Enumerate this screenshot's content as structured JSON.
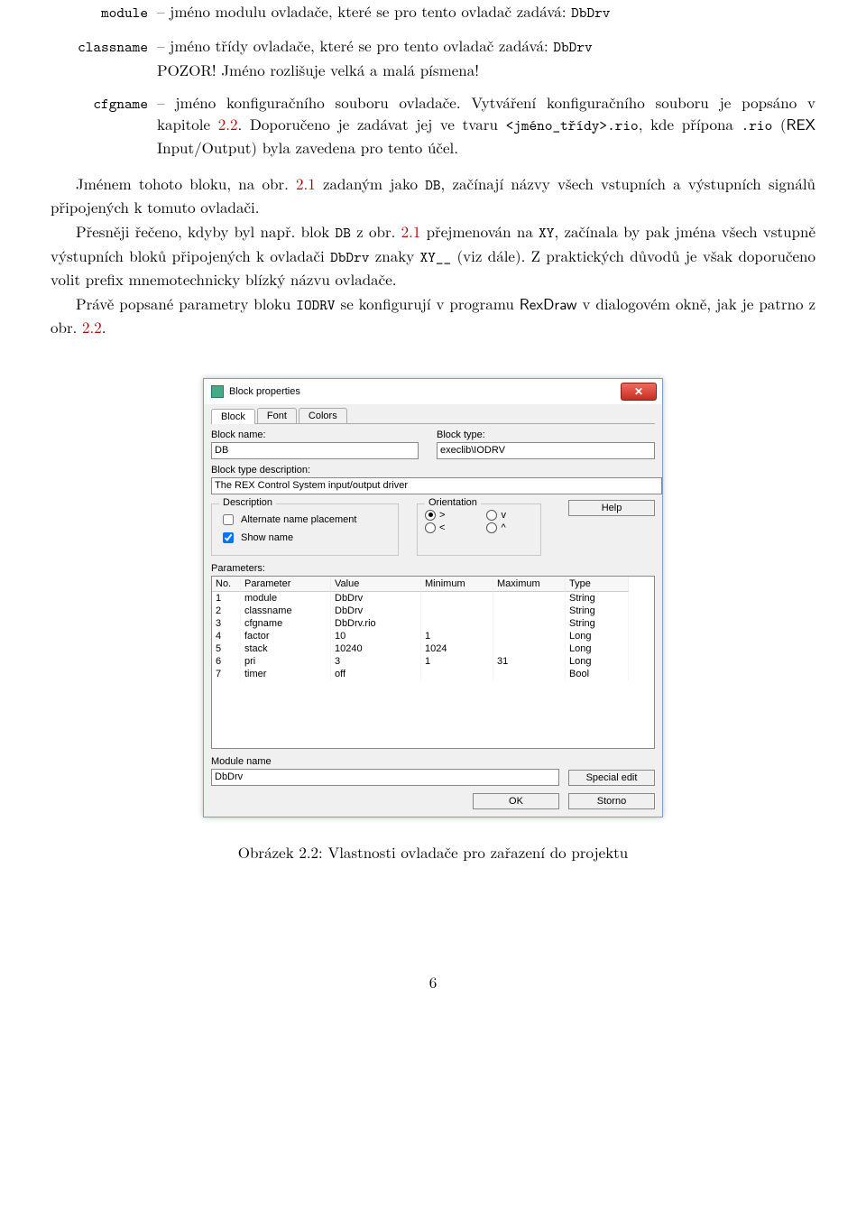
{
  "defs": {
    "module": {
      "term": "module",
      "pre": "– jméno modulu ovladače, které se pro tento ovladač zadává: ",
      "code": "DbDrv",
      "post": ""
    },
    "classname": {
      "term": "classname",
      "line1_pre": "– jméno třídy ovladače, které se pro tento ovladač zadává: ",
      "line1_code": "DbDrv",
      "line2": "POZOR! Jméno rozlišuje velká a malá písmena!"
    },
    "cfgname": {
      "term": "cfgname",
      "text_a": "– jméno konfiguračního souboru ovladače. Vytváření konfiguračního souboru je popsáno v kapitole ",
      "ref1": "2.2",
      "text_b": ". Doporučeno je zadávat jej ve tvaru ",
      "code1": "<jméno_třídy>.rio",
      "text_c": ", kde přípona ",
      "code2": ".rio",
      "text_d": " (",
      "sf1": "REX",
      "text_e": " Input/Output) byla zavedena pro tento účel."
    }
  },
  "p1": {
    "a": "Jménem tohoto bloku, na obr. ",
    "ref": "2.1",
    "b": " zadaným jako ",
    "code": "DB",
    "c": ", začínají názvy všech vstupních a výstupních signálů připojených k tomuto ovladači."
  },
  "p2": {
    "a": "Přesněji řečeno, kdyby byl např. blok ",
    "code1": "DB",
    "b": " z obr. ",
    "ref": "2.1",
    "c": " přejmenován na ",
    "code2": "XY",
    "d": ", začínala by pak jména všech vstupně výstupních bloků připojených k ovladači ",
    "code3": "DbDrv",
    "e": " znaky ",
    "code4": "XY__",
    "f": " (viz dále). Z praktických důvodů je však doporučeno volit prefix mnemotechnicky blízký názvu ovladače."
  },
  "p3": {
    "a": "Právě popsané parametry bloku ",
    "code1": "IODRV",
    "b": " se konfigurují v programu ",
    "sf": "RexDraw",
    "c": " v dialogovém okně, jak je patrno z obr. ",
    "ref": "2.2",
    "d": "."
  },
  "dialog": {
    "title": "Block properties",
    "tabs": [
      "Block",
      "Font",
      "Colors"
    ],
    "blockname_label": "Block name:",
    "blockname_value": "DB",
    "blocktype_label": "Block type:",
    "blocktype_value": "execlib\\IODRV",
    "desc_label": "Block type description:",
    "desc_value": "The REX Control System input/output driver",
    "group_desc": "Description",
    "chk_alt": "Alternate name placement",
    "chk_alt_checked": false,
    "chk_show": "Show name",
    "chk_show_checked": true,
    "group_orient": "Orientation",
    "orient_opts": [
      ">",
      "v",
      "<",
      "^"
    ],
    "orient_selected": 0,
    "help_btn": "Help",
    "params_label": "Parameters:",
    "cols": [
      "No.",
      "Parameter",
      "Value",
      "Minimum",
      "Maximum",
      "Type"
    ],
    "rows": [
      [
        "1",
        "module",
        "DbDrv",
        "",
        "",
        "String"
      ],
      [
        "2",
        "classname",
        "DbDrv",
        "",
        "",
        "String"
      ],
      [
        "3",
        "cfgname",
        "DbDrv.rio",
        "",
        "",
        "String"
      ],
      [
        "4",
        "factor",
        "10",
        "1",
        "",
        "Long"
      ],
      [
        "5",
        "stack",
        "10240",
        "1024",
        "",
        "Long"
      ],
      [
        "6",
        "pri",
        "3",
        "1",
        "31",
        "Long"
      ],
      [
        "7",
        "timer",
        "off",
        "",
        "",
        "Bool"
      ]
    ],
    "modname_label": "Module name",
    "modname_value": "DbDrv",
    "special_btn": "Special edit",
    "ok_btn": "OK",
    "storno_btn": "Storno"
  },
  "caption": "Obrázek 2.2: Vlastnosti ovladače pro zařazení do projektu",
  "pagenum": "6"
}
